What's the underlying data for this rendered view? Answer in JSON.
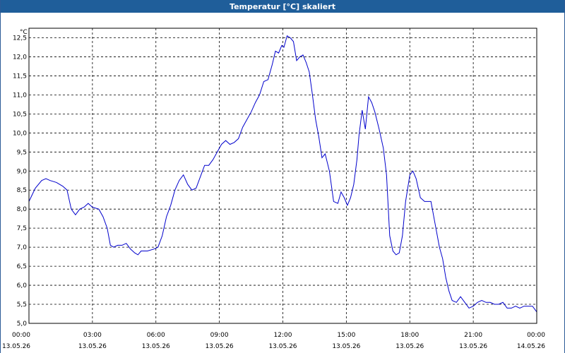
{
  "window": {
    "title": "Temperatur [°C] skaliert"
  },
  "chart_data": {
    "type": "line",
    "title": "Temperatur [°C] skaliert",
    "ylabel": "°C",
    "xlabel": "",
    "ylim": [
      5.0,
      12.75
    ],
    "yticks": [
      "12,5",
      "12,0",
      "11,5",
      "11,0",
      "10,5",
      "10,0",
      "9,5",
      "9,0",
      "8,5",
      "8,0",
      "7,5",
      "7,0",
      "6,5",
      "6,0",
      "5,5",
      "5,0"
    ],
    "ytick_values": [
      12.5,
      12.0,
      11.5,
      11.0,
      10.5,
      10.0,
      9.5,
      9.0,
      8.5,
      8.0,
      7.5,
      7.0,
      6.5,
      6.0,
      5.5,
      5.0
    ],
    "xlim_hours": [
      0,
      24
    ],
    "xticks": [
      {
        "time": "00:00",
        "date": "13.05.26",
        "hour": 0
      },
      {
        "time": "03:00",
        "date": "13.05.26",
        "hour": 3
      },
      {
        "time": "06:00",
        "date": "13.05.26",
        "hour": 6
      },
      {
        "time": "09:00",
        "date": "13.05.26",
        "hour": 9
      },
      {
        "time": "12:00",
        "date": "13.05.26",
        "hour": 12
      },
      {
        "time": "15:00",
        "date": "13.05.26",
        "hour": 15
      },
      {
        "time": "18:00",
        "date": "13.05.26",
        "hour": 18
      },
      {
        "time": "21:00",
        "date": "13.05.26",
        "hour": 21
      },
      {
        "time": "00:00",
        "date": "14.05.26",
        "hour": 24
      }
    ],
    "grid": true,
    "line_color": "#0000cc",
    "series": [
      {
        "points": [
          [
            0.0,
            8.2
          ],
          [
            0.3,
            8.55
          ],
          [
            0.6,
            8.75
          ],
          [
            0.8,
            8.8
          ],
          [
            1.0,
            8.75
          ],
          [
            1.3,
            8.7
          ],
          [
            1.6,
            8.6
          ],
          [
            1.8,
            8.5
          ],
          [
            2.0,
            8.0
          ],
          [
            2.2,
            7.85
          ],
          [
            2.4,
            8.0
          ],
          [
            2.6,
            8.05
          ],
          [
            2.8,
            8.15
          ],
          [
            3.0,
            8.05
          ],
          [
            3.3,
            8.0
          ],
          [
            3.5,
            7.8
          ],
          [
            3.7,
            7.5
          ],
          [
            3.85,
            7.05
          ],
          [
            4.0,
            7.0
          ],
          [
            4.2,
            7.05
          ],
          [
            4.4,
            7.05
          ],
          [
            4.6,
            7.1
          ],
          [
            4.8,
            6.95
          ],
          [
            5.0,
            6.85
          ],
          [
            5.15,
            6.8
          ],
          [
            5.3,
            6.9
          ],
          [
            5.6,
            6.9
          ],
          [
            5.9,
            6.95
          ],
          [
            6.1,
            7.0
          ],
          [
            6.3,
            7.3
          ],
          [
            6.5,
            7.8
          ],
          [
            6.7,
            8.1
          ],
          [
            6.9,
            8.5
          ],
          [
            7.1,
            8.75
          ],
          [
            7.3,
            8.9
          ],
          [
            7.5,
            8.65
          ],
          [
            7.7,
            8.5
          ],
          [
            7.9,
            8.55
          ],
          [
            8.1,
            8.85
          ],
          [
            8.3,
            9.15
          ],
          [
            8.5,
            9.15
          ],
          [
            8.7,
            9.3
          ],
          [
            8.9,
            9.5
          ],
          [
            9.1,
            9.7
          ],
          [
            9.3,
            9.8
          ],
          [
            9.5,
            9.7
          ],
          [
            9.7,
            9.75
          ],
          [
            9.9,
            9.85
          ],
          [
            10.1,
            10.15
          ],
          [
            10.3,
            10.35
          ],
          [
            10.5,
            10.55
          ],
          [
            10.7,
            10.8
          ],
          [
            10.9,
            11.0
          ],
          [
            11.1,
            11.35
          ],
          [
            11.3,
            11.4
          ],
          [
            11.5,
            11.8
          ],
          [
            11.65,
            12.15
          ],
          [
            11.8,
            12.1
          ],
          [
            11.95,
            12.3
          ],
          [
            12.05,
            12.25
          ],
          [
            12.2,
            12.55
          ],
          [
            12.35,
            12.5
          ],
          [
            12.5,
            12.4
          ],
          [
            12.65,
            11.9
          ],
          [
            12.8,
            12.0
          ],
          [
            12.95,
            12.05
          ],
          [
            13.1,
            11.85
          ],
          [
            13.25,
            11.6
          ],
          [
            13.4,
            11.0
          ],
          [
            13.55,
            10.35
          ],
          [
            13.7,
            9.9
          ],
          [
            13.85,
            9.35
          ],
          [
            14.0,
            9.45
          ],
          [
            14.2,
            9.0
          ],
          [
            14.4,
            8.2
          ],
          [
            14.6,
            8.15
          ],
          [
            14.75,
            8.45
          ],
          [
            14.9,
            8.3
          ],
          [
            15.05,
            8.1
          ],
          [
            15.2,
            8.3
          ],
          [
            15.35,
            8.65
          ],
          [
            15.5,
            9.3
          ],
          [
            15.6,
            9.95
          ],
          [
            15.75,
            10.6
          ],
          [
            15.9,
            10.1
          ],
          [
            16.05,
            10.95
          ],
          [
            16.2,
            10.8
          ],
          [
            16.35,
            10.55
          ],
          [
            16.55,
            10.1
          ],
          [
            16.75,
            9.6
          ],
          [
            16.9,
            8.9
          ],
          [
            17.05,
            7.3
          ],
          [
            17.2,
            6.9
          ],
          [
            17.35,
            6.8
          ],
          [
            17.5,
            6.85
          ],
          [
            17.65,
            7.3
          ],
          [
            17.8,
            8.2
          ],
          [
            18.0,
            8.9
          ],
          [
            18.15,
            9.0
          ],
          [
            18.3,
            8.8
          ],
          [
            18.5,
            8.3
          ],
          [
            18.7,
            8.2
          ],
          [
            19.0,
            8.2
          ],
          [
            19.2,
            7.6
          ],
          [
            19.4,
            7.0
          ],
          [
            19.55,
            6.7
          ],
          [
            19.7,
            6.2
          ],
          [
            19.85,
            5.85
          ],
          [
            20.0,
            5.6
          ],
          [
            20.2,
            5.55
          ],
          [
            20.4,
            5.7
          ],
          [
            20.6,
            5.55
          ],
          [
            20.8,
            5.4
          ],
          [
            21.0,
            5.45
          ],
          [
            21.2,
            5.55
          ],
          [
            21.4,
            5.6
          ],
          [
            21.6,
            5.55
          ],
          [
            21.8,
            5.55
          ],
          [
            22.0,
            5.5
          ],
          [
            22.2,
            5.5
          ],
          [
            22.4,
            5.55
          ],
          [
            22.6,
            5.4
          ],
          [
            22.8,
            5.4
          ],
          [
            23.0,
            5.45
          ],
          [
            23.2,
            5.4
          ],
          [
            23.4,
            5.45
          ],
          [
            23.6,
            5.45
          ],
          [
            23.8,
            5.45
          ],
          [
            24.0,
            5.3
          ]
        ]
      }
    ]
  }
}
